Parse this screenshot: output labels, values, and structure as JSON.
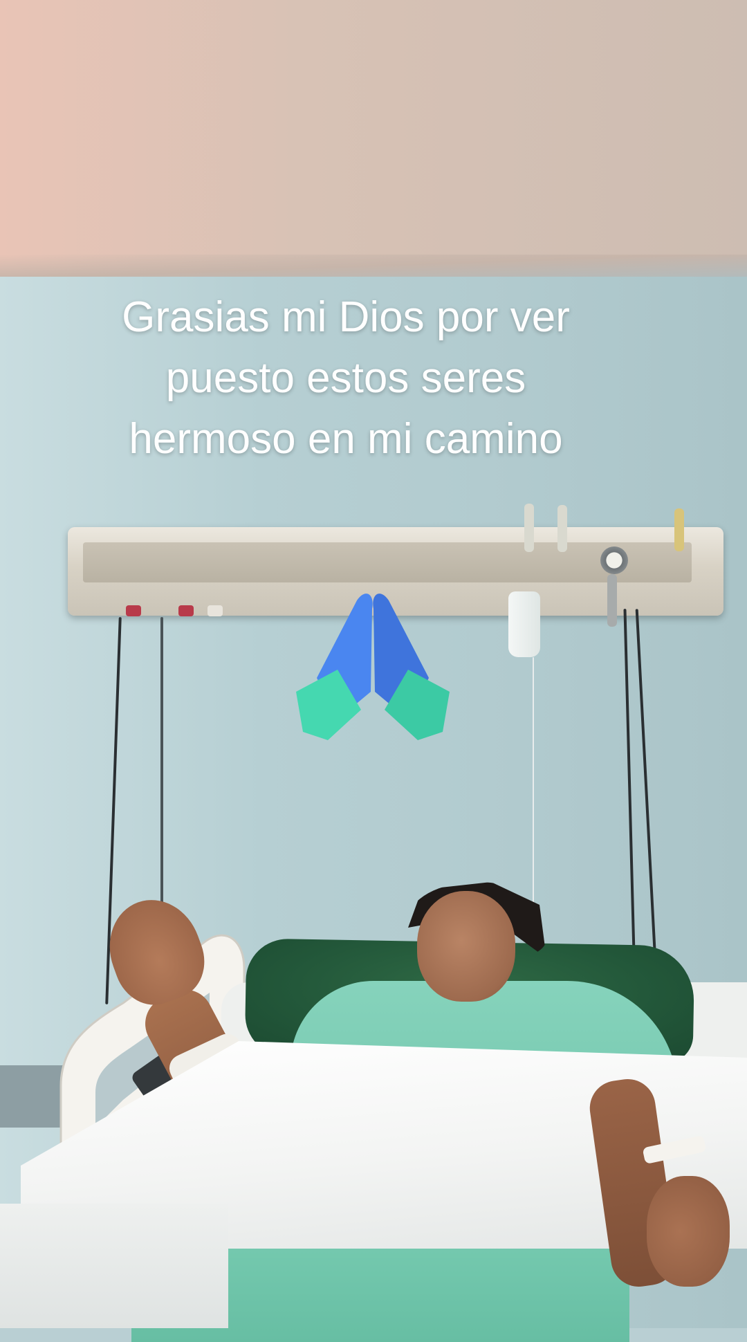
{
  "caption": {
    "text": "Grasias mi Dios por ver\npuesto estos seres\nhermoso en mi camino"
  },
  "sticker": {
    "icon": "folded-hands-icon",
    "colors": {
      "hands": "#4a86f0",
      "sleeves": "#45d8b0"
    }
  },
  "scene": {
    "colors": {
      "wall": "#b6cfd3",
      "ceiling": "#dcc3b6",
      "pillow": "#23583a",
      "gown": "#7ccfb5"
    }
  }
}
